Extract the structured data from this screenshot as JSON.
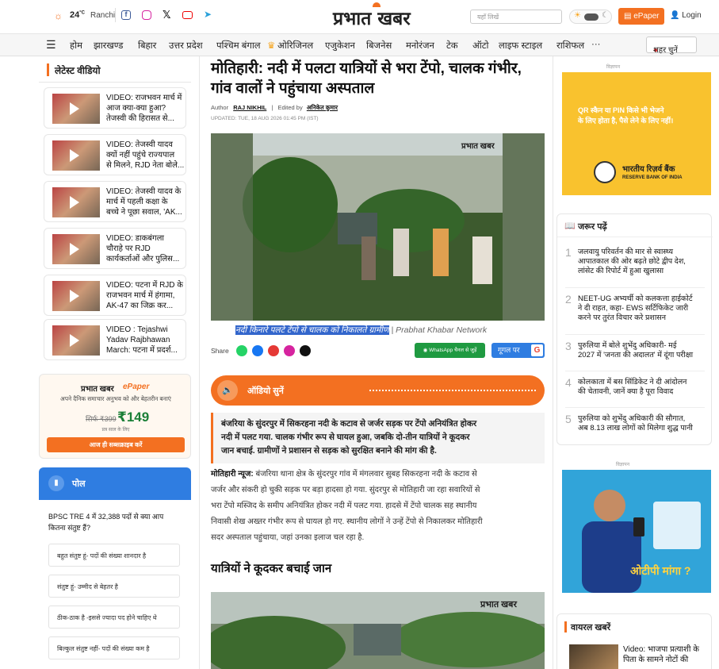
{
  "header": {
    "temp": "24",
    "temp_unit": "°C",
    "city": "Ranchi",
    "logo": "प्रभात खबर",
    "search_placeholder": "यहाँ लिखें",
    "epaper": "ePaper",
    "login": "Login"
  },
  "nav": [
    "होम",
    "झारखण्ड",
    "बिहार",
    "उत्तर प्रदेश",
    "पश्चिम बंगाल",
    "ओरिजिनल",
    "एजुकेशन",
    "बिजनेस",
    "मनोरंजन",
    "टेक",
    "ऑटो",
    "लाइफ स्टाइल",
    "राशिफल",
    "···"
  ],
  "city_btn": "शहर चुनें",
  "left": {
    "videos_title": "लेटेस्ट वीडियो",
    "videos": [
      {
        "line1": "VIDEO: राजभवन मार्च में",
        "line2": "आज क्या-क्या हुआ?",
        "line3": "तेजस्वी की हिरासत से..."
      },
      {
        "line1": "VIDEO: तेजस्वी यादव",
        "line2": "क्यों नहीं पहुंचे राज्यपाल",
        "line3": "से मिलने, RJD नेता बोले..."
      },
      {
        "line1": "VIDEO: तेजस्वी यादव के",
        "line2": "मार्च में पहली कक्षा के",
        "line3": "बच्चे ने पूछा सवाल, 'AK..."
      },
      {
        "line1": "VIDEO: डाकबंगला",
        "line2": "चौराहे पर RJD",
        "line3": "कार्यकर्ताओं और पुलिस..."
      },
      {
        "line1": "VIDEO: पटना में RJD के",
        "line2": "राजभवन मार्च में हंगामा,",
        "line3": "AK-47 का जिक्र कर..."
      },
      {
        "line1": "VIDEO : Tejashwi",
        "line2": "Yadav Rajbhawan",
        "line3": "March: पटना में प्रदर्श..."
      }
    ],
    "epaper": {
      "logo": "प्रभात खबर",
      "label": "ePaper",
      "tagline": "अपने दैनिक समाचार अनुभव को और बेहतरीन बनाएं",
      "old_price": "सिर्फ ₹399",
      "price": "₹149",
      "period": "प्रत्र साल के लिए",
      "cta": "आज ही सब्सक्राइब करें"
    },
    "poll": {
      "title": "पोल",
      "question_l1": "BPSC TRE 4 में 32,388 पदों से क्या आप",
      "question_l2": "कितना संतुष्ट हैं?",
      "options": [
        "बहुत संतुष्ट हूं- पदों की संख्या शानदार है",
        "संतुष्ट हूं- उम्मीद से बेहतर है",
        "ठीक-ठाक है -इससे ज्यादा पद होने चाहिए थे",
        "बिल्कुल संतुष्ट नहीं- पदों की संख्या कम है"
      ]
    }
  },
  "article": {
    "title_l1": "मोतिहारी: नदी में पलटा यात्रियों से भरा टेंपो, चालक गंभीर,",
    "title_l2": "गांव वालों ने पहुंचाया अस्पताल",
    "author_label": "Author",
    "author": "RAJ NIKHIL",
    "editor_label": "Edited by",
    "editor": "अनिकेत कुमार",
    "updated": "UPDATED: TUE, 18 AUG 2026 01:45 PM (IST)",
    "watermark": "प्रभात खबर",
    "caption": "नदी किनारे पलटे टेंपो से चालक को निकालते ग्रामीण",
    "caption_credit": "| Prabhat Khabar Network",
    "share_label": "Share",
    "whatsapp_btn": "WhatsApp चैनल से जुड़ें",
    "google_btn": "गूगल पर",
    "audio_label": "ऑडियो सुनें",
    "summary_l1": "बंजरिया के सुंदरपुर में सिकरहना नदी के कटाव से जर्जर सड़क पर टेंपो अनियंत्रित होकर",
    "summary_l2": "नदी में पलट गया. चालक गंभीर रूप से घायल हुआ, जबकि दो-तीन यात्रियों ने कूदकर",
    "summary_l3": "जान बचाई. ग्रामीणों ने प्रशासन से सड़क को सुरक्षित बनाने की मांग की है.",
    "body_lead": "मोतिहारी न्यूज:",
    "body_l1": " बंजरिया थाना क्षेत्र के सुंदरपुर गांव में मंगलवार सुबह सिकरहना नदी के कटाव से",
    "body_l2": "जर्जर और संकरी हो चुकी सड़क पर बड़ा हादसा हो गया. सुंदरपुर से मोतिहारी जा रहा सवारियों से",
    "body_l3": "भरा टेंपो मस्जिद के समीप अनियंत्रित होकर नदी में पलट गया. हादसे में टेंपो चालक सह स्थानीय",
    "body_l4": "निवासी शेख अख्तर गंभीर रूप से घायल हो गए. स्थानीय लोगों ने उन्हें टेंपो से निकालकर मोतिहारी",
    "body_l5": "सदर अस्पताल पहुंचाया, जहां उनका इलाज चल रहा है.",
    "subheading": "यात्रियों ने कूदकर बचाई जान"
  },
  "right": {
    "ad_label": "विज्ञापन",
    "ad1_l1": "QR स्कैन या PIN किसे भी भेजने",
    "ad1_l2": "के लिए होता है, पैसे लेने के लिए नहीं।",
    "ad1_bank": "भारतीय रिज़र्व बैंक",
    "ad1_bank_en": "RESERVE BANK OF INDIA",
    "must_title": "जरूर पढ़ें",
    "must": [
      {
        "n": "1",
        "l1": "जलवायु परिवर्तन की मार से स्वास्थ्य",
        "l2": "आपातकाल की ओर बढ़ते छोटे द्वीप देश,",
        "l3": "लांसेट की रिपोर्ट में हुआ खुलासा"
      },
      {
        "n": "2",
        "l1": "NEET-UG अभ्यर्थी को कलकत्ता हाईकोर्ट",
        "l2": "ने दी राहत, कहा- EWS सर्टिफिकेट जारी",
        "l3": "करने पर तुरंत विचार करे प्रशासन"
      },
      {
        "n": "3",
        "l1": "पुरुलिया में बोले शुभेंदु अधिकारी- मई",
        "l2": "2027 में 'जनता की अदालत' में दूंगा परीक्षा",
        "l3": ""
      },
      {
        "n": "4",
        "l1": "कोलकाता में बस सिंडिकेट ने दी आंदोलन",
        "l2": "की चेतावनी, जानें क्या है पूरा विवाद",
        "l3": ""
      },
      {
        "n": "5",
        "l1": "पुरुलिया को शुभेंदु अधिकारी की सौगात,",
        "l2": "अब 8.13 लाख लोगों को मिलेगा शुद्ध पानी",
        "l3": ""
      }
    ],
    "ad2_text": "ओटीपी मांगा ?",
    "viral_title": "वायरल खबरें",
    "viral_l1": "Video: भाजपा प्रत्याशी के",
    "viral_l2": "पिता के सामने नोटों की"
  },
  "colors": {
    "accent": "#f37021",
    "blue": "#2f7de1"
  }
}
